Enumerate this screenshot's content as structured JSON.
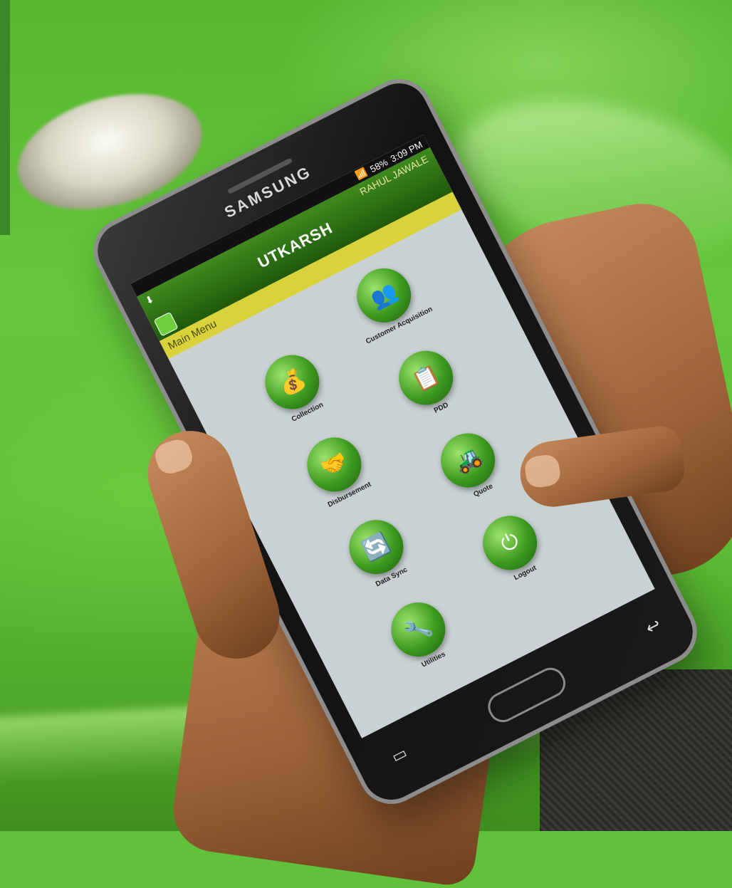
{
  "device": {
    "brand": "SAMSUNG"
  },
  "status_bar": {
    "signal": "📶",
    "battery": "58%",
    "time": "3:09 PM"
  },
  "app": {
    "title": "UTKARSH",
    "user": "RAHUL  JAWALE",
    "section": "Main Menu",
    "download_icon": "⬇"
  },
  "menu": [
    {
      "label": "Customer Acquisition",
      "icon": "👥"
    },
    {
      "label": "Collection",
      "icon": "💰"
    },
    {
      "label": "PDD",
      "icon": "📋"
    },
    {
      "label": "Disbursement",
      "icon": "🤝"
    },
    {
      "label": "Quote",
      "icon": "🚜"
    },
    {
      "label": "Data Sync",
      "icon": "🔄"
    },
    {
      "label": "Logout",
      "icon": "⏻"
    },
    {
      "label": "Utilities",
      "icon": "🔧"
    }
  ],
  "nav": {
    "back": "↩",
    "recent": "▭"
  },
  "colors": {
    "header": "#2f7a14",
    "menu_bar": "#d9d23a",
    "screen": "#c9d1d2"
  }
}
